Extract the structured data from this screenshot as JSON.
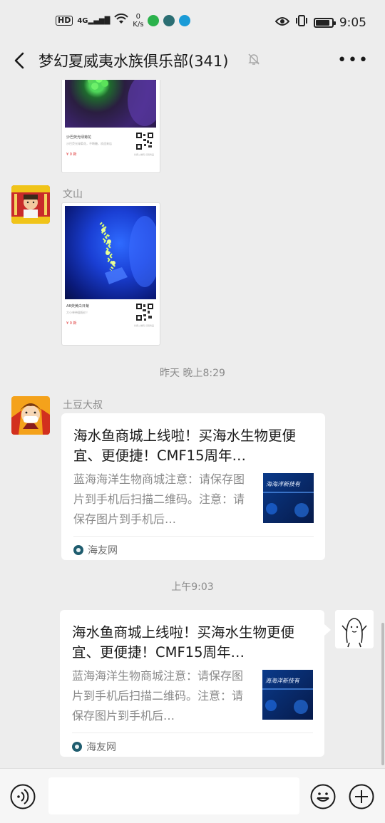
{
  "status_bar": {
    "hd": "HD",
    "network": "4G",
    "speed_value": "0",
    "speed_unit": "K/s",
    "time": "9:05",
    "battery_level": 0.85,
    "app_icon_colors": [
      "#2bb24c",
      "#2b6e73",
      "#1a9bd7"
    ]
  },
  "header": {
    "title": "梦幻夏威夷水族俱乐部(341)",
    "back_icon": "back-chevron-icon",
    "mute_icon": "bell-muted-icon",
    "more_icon": "more-dots-icon",
    "more_label": "•••"
  },
  "messages": [
    {
      "type": "image",
      "direction": "incoming",
      "caption": "沙巴荧光绿菊花",
      "subcaption": "沙巴荧光绿菊花，不断糖，欢迎来店",
      "price_mark": "¥ 0 新",
      "qr_note": "长按二维码 识别商品"
    },
    {
      "type": "image",
      "direction": "incoming",
      "sender": "文山",
      "caption": "AB荧黄白日菊",
      "subcaption": "大小单带量报价！",
      "price_mark": "¥ 0 新",
      "qr_note": "长按二维码 识别商品"
    },
    {
      "type": "timestamp",
      "text": "昨天 晚上8:29"
    },
    {
      "type": "link",
      "direction": "incoming",
      "sender": "土豆大叔",
      "title": "海水鱼商城上线啦！买海水生物更便宜、更便捷！CMF15周年…",
      "description": "蓝海海洋生物商城注意：请保存图片到手机后扫描二维码。注意：请保存图片到手机后…",
      "thumb_text": "海海洋新技有",
      "source": "海友网"
    },
    {
      "type": "timestamp",
      "text": "上午9:03"
    },
    {
      "type": "link",
      "direction": "outgoing",
      "title": "海水鱼商城上线啦！买海水生物更便宜、更便捷！CMF15周年…",
      "description": "蓝海海洋生物商城注意：请保存图片到手机后扫描二维码。注意：请保存图片到手机后…",
      "thumb_text": "海海洋新技有",
      "source": "海友网"
    }
  ],
  "input_bar": {
    "voice_icon": "voice-icon",
    "emoji_icon": "emoji-icon",
    "plus_icon": "plus-icon"
  }
}
